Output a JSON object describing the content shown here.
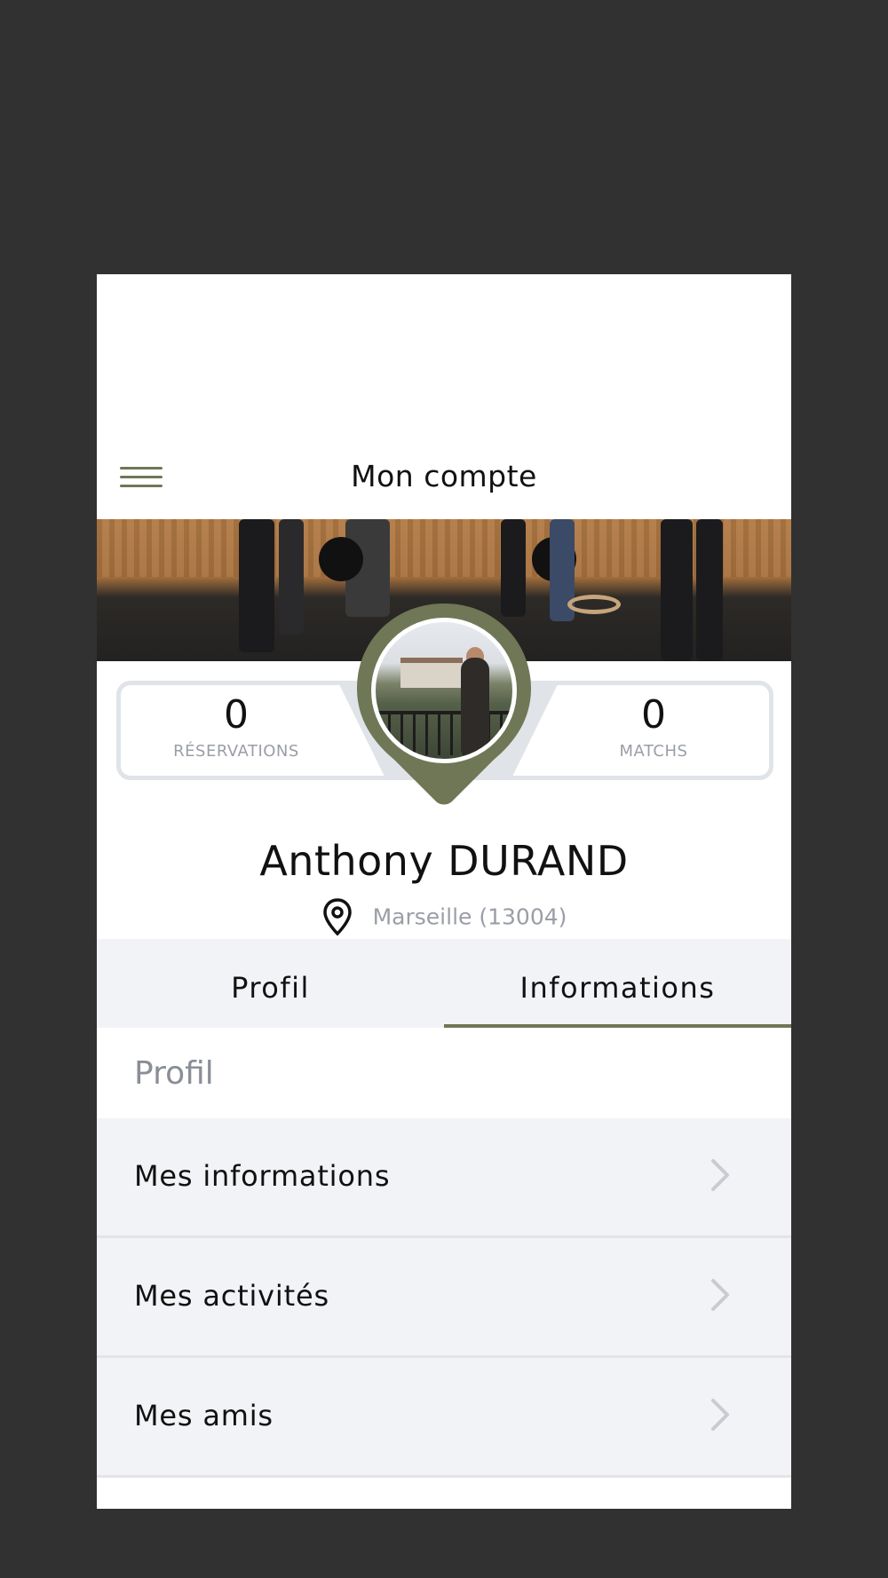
{
  "header": {
    "title": "Mon compte",
    "menu_icon": "hamburger-menu-icon"
  },
  "stats": {
    "reservations": {
      "value": "0",
      "label": "RÉSERVATIONS"
    },
    "matchs": {
      "value": "0",
      "label": "MATCHS"
    }
  },
  "user": {
    "first_name": "Anthony",
    "last_name": "DURAND",
    "location": "Marseille (13004)"
  },
  "tabs": [
    {
      "label": "Profil",
      "active": false
    },
    {
      "label": "Informations",
      "active": true
    }
  ],
  "section": {
    "title": "Profil"
  },
  "menu_items": [
    {
      "label": "Mes informations"
    },
    {
      "label": "Mes activités"
    },
    {
      "label": "Mes amis"
    }
  ],
  "colors": {
    "accent": "#6f7756",
    "background": "#313131",
    "panel": "#f2f3f6",
    "muted_text": "#9a9ea6"
  }
}
